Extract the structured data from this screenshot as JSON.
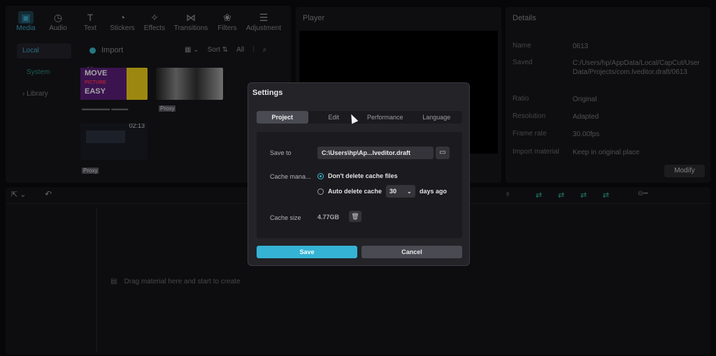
{
  "media": {
    "tabs": [
      {
        "label": "Media",
        "icon": "media-icon"
      },
      {
        "label": "Audio",
        "icon": "audio-icon"
      },
      {
        "label": "Text",
        "icon": "text-icon"
      },
      {
        "label": "Stickers",
        "icon": "stickers-icon"
      },
      {
        "label": "Effects",
        "icon": "effects-icon"
      },
      {
        "label": "Transitions",
        "icon": "transitions-icon"
      },
      {
        "label": "Filters",
        "icon": "filters-icon"
      },
      {
        "label": "Adjustment",
        "icon": "adjustment-icon"
      }
    ],
    "side": [
      "Local",
      "System",
      "Library"
    ],
    "import_label": "Import",
    "sort_label": "Sort",
    "all_label": "All",
    "section_all": "All",
    "thumb1_text": [
      "MOVE",
      "PICTURE",
      "EASY"
    ],
    "thumb3_time": "02:13",
    "proxy_label": "Proxy"
  },
  "player": {
    "title": "Player"
  },
  "details": {
    "title": "Details",
    "rows": [
      {
        "k": "Name",
        "v": "0613"
      },
      {
        "k": "Saved",
        "v": "C:/Users/hp/AppData/Local/CapCut/User Data/Projects/com.lveditor.draft/0613"
      },
      {
        "k": "Ratio",
        "v": "Original"
      },
      {
        "k": "Resolution",
        "v": "Adapted"
      },
      {
        "k": "Frame rate",
        "v": "30.00fps"
      },
      {
        "k": "Import material",
        "v": "Keep in original place"
      }
    ],
    "modify_label": "Modify"
  },
  "timeline": {
    "drag_hint": "Drag material here and start to create"
  },
  "settings": {
    "title": "Settings",
    "tabs": [
      "Project",
      "Edit",
      "Performance",
      "Language"
    ],
    "save_to_label": "Save to",
    "save_path": "C:\\Users\\hp\\Ap...lveditor.draft",
    "cache_label": "Cache mana...",
    "opt_dont_delete": "Don't delete cache files",
    "opt_auto_delete": "Auto delete cache",
    "auto_days": "30",
    "days_ago": "days ago",
    "cache_size_label": "Cache size",
    "cache_size_value": "4.77GB",
    "save_button": "Save",
    "cancel_button": "Cancel"
  },
  "colors": {
    "accent": "#35b3d4",
    "bg": "#0c0c0e"
  }
}
